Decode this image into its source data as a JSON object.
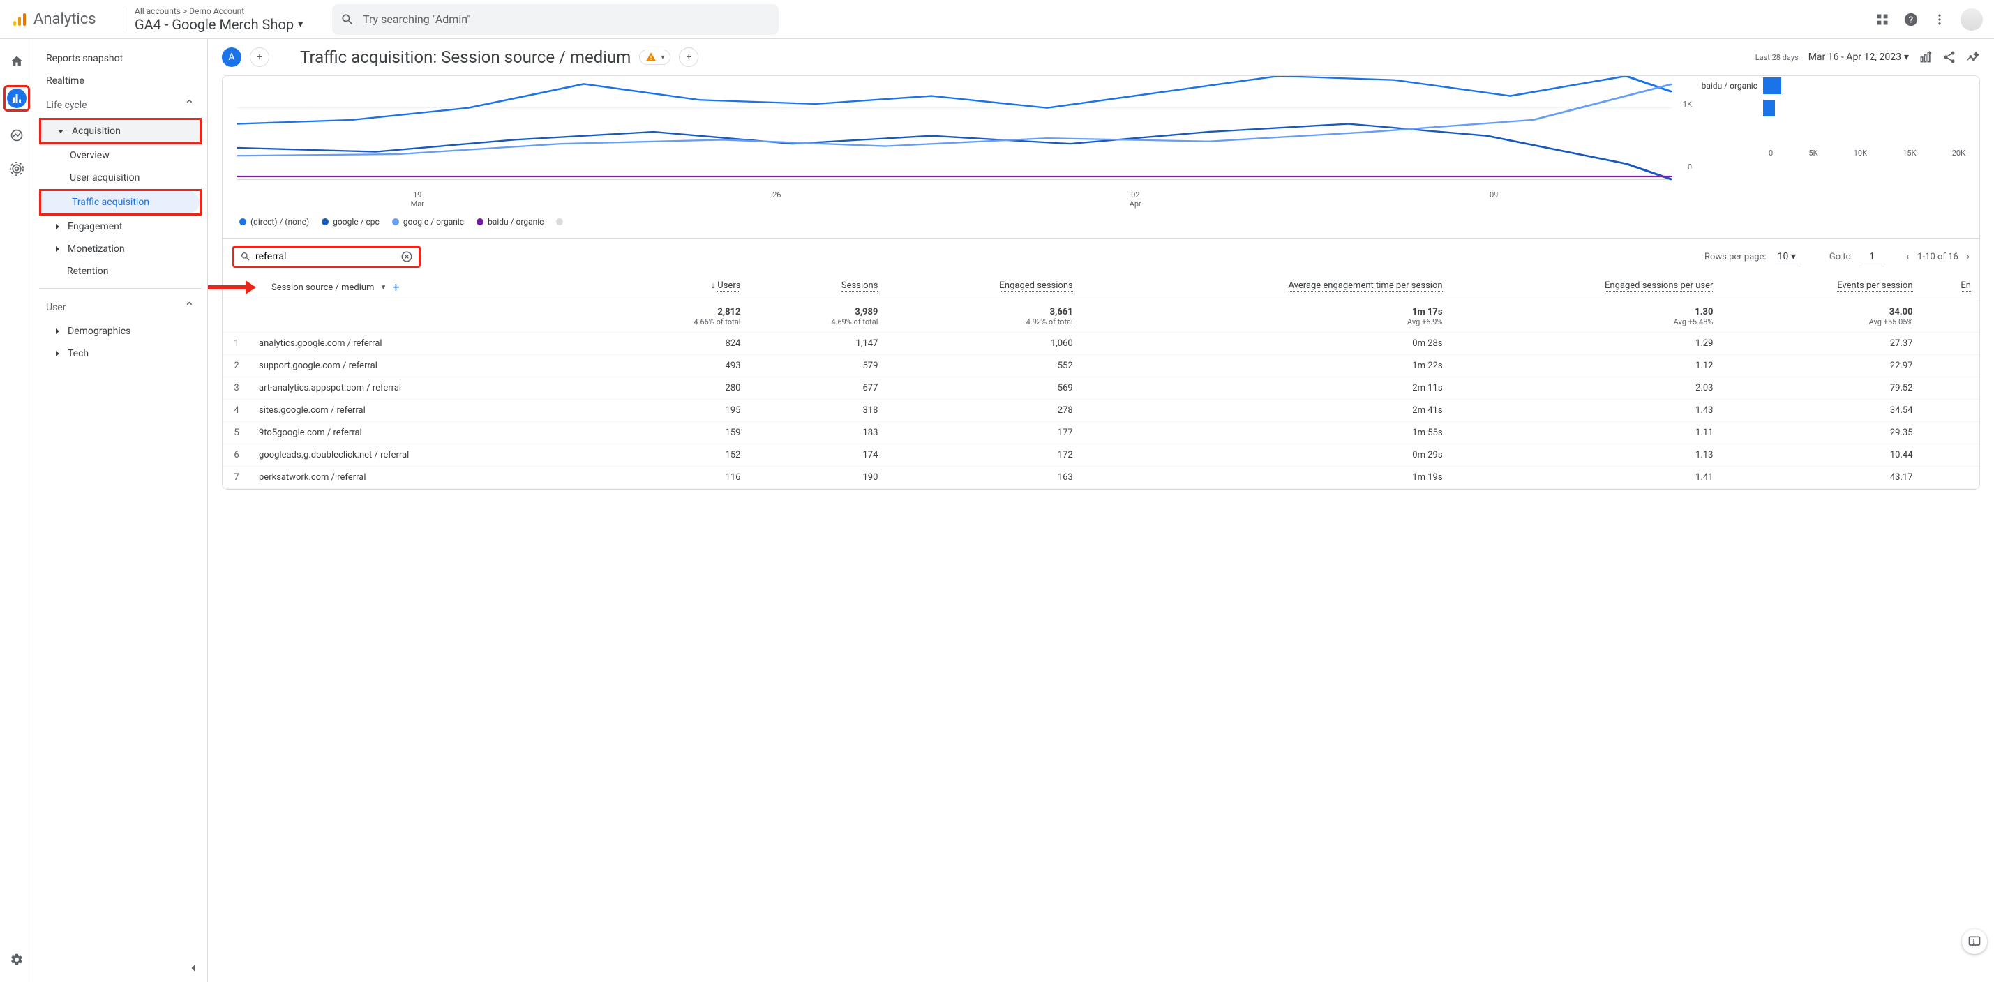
{
  "header": {
    "product": "Analytics",
    "breadcrumbs": "All accounts > Demo Account",
    "property": "GA4 - Google Merch Shop",
    "search_placeholder": "Try searching \"Admin\""
  },
  "sidebar": {
    "snapshot": "Reports snapshot",
    "realtime": "Realtime",
    "lifecycle": "Life cycle",
    "acquisition": "Acquisition",
    "overview": "Overview",
    "user_acq": "User acquisition",
    "traffic_acq": "Traffic acquisition",
    "engagement": "Engagement",
    "monetization": "Monetization",
    "retention": "Retention",
    "user": "User",
    "demographics": "Demographics",
    "tech": "Tech"
  },
  "page": {
    "avatar_letter": "A",
    "title": "Traffic acquisition: Session source / medium",
    "date_label": "Last 28 days",
    "date_range": "Mar 16 - Apr 12, 2023"
  },
  "chart_data": {
    "line": {
      "type": "line",
      "x_ticks": [
        {
          "top": "19",
          "bottom": "Mar"
        },
        {
          "top": "26",
          "bottom": ""
        },
        {
          "top": "02",
          "bottom": "Apr"
        },
        {
          "top": "09",
          "bottom": ""
        }
      ],
      "y_ticks": [
        "1K",
        "0"
      ],
      "series": [
        {
          "name": "(direct) / (none)",
          "color": "#1a73e8"
        },
        {
          "name": "google / cpc",
          "color": "#185abc"
        },
        {
          "name": "google / organic",
          "color": "#669df6"
        },
        {
          "name": "baidu / organic",
          "color": "#7b1fa2"
        }
      ]
    },
    "bar": {
      "type": "bar",
      "label": "baidu / organic",
      "bars": [
        {
          "width_pct": 9
        },
        {
          "width_pct": 6
        }
      ],
      "x_ticks": [
        "0",
        "5K",
        "10K",
        "15K",
        "20K"
      ]
    }
  },
  "table": {
    "search_value": "referral",
    "rows_per_page_label": "Rows per page:",
    "rows_per_page": "10",
    "goto_label": "Go to:",
    "goto_value": "1",
    "page_range": "1-10 of 16",
    "dimension": "Session source / medium",
    "columns": [
      "Users",
      "Sessions",
      "Engaged sessions",
      "Average engagement time per session",
      "Engaged sessions per user",
      "Events per session",
      "En"
    ],
    "totals": {
      "values": [
        "2,812",
        "3,989",
        "3,661",
        "1m 17s",
        "1.30",
        "34.00",
        ""
      ],
      "subs": [
        "4.66% of total",
        "4.69% of total",
        "4.92% of total",
        "Avg +6.9%",
        "Avg +5.48%",
        "Avg +55.05%",
        ""
      ]
    },
    "rows": [
      {
        "n": "1",
        "dim": "analytics.google.com / referral",
        "v": [
          "824",
          "1,147",
          "1,060",
          "0m 28s",
          "1.29",
          "27.37",
          ""
        ]
      },
      {
        "n": "2",
        "dim": "support.google.com / referral",
        "v": [
          "493",
          "579",
          "552",
          "1m 22s",
          "1.12",
          "22.97",
          ""
        ]
      },
      {
        "n": "3",
        "dim": "art-analytics.appspot.com / referral",
        "v": [
          "280",
          "677",
          "569",
          "2m 11s",
          "2.03",
          "79.52",
          ""
        ]
      },
      {
        "n": "4",
        "dim": "sites.google.com / referral",
        "v": [
          "195",
          "318",
          "278",
          "2m 41s",
          "1.43",
          "34.54",
          ""
        ]
      },
      {
        "n": "5",
        "dim": "9to5google.com / referral",
        "v": [
          "159",
          "183",
          "177",
          "1m 55s",
          "1.11",
          "29.35",
          ""
        ]
      },
      {
        "n": "6",
        "dim": "googleads.g.doubleclick.net / referral",
        "v": [
          "152",
          "174",
          "172",
          "0m 29s",
          "1.13",
          "10.44",
          ""
        ]
      },
      {
        "n": "7",
        "dim": "perksatwork.com / referral",
        "v": [
          "116",
          "190",
          "163",
          "1m 19s",
          "1.41",
          "43.17",
          ""
        ]
      }
    ]
  }
}
